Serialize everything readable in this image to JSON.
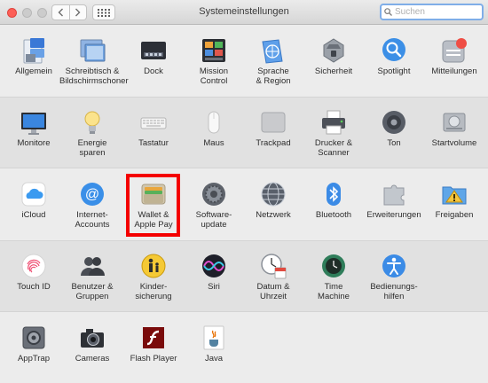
{
  "window": {
    "title": "Systemeinstellungen"
  },
  "search": {
    "placeholder": "Suchen",
    "value": ""
  },
  "rows": [
    [
      "Allgemein",
      "Schreibtisch &\nBildschirmschoner",
      "Dock",
      "Mission\nControl",
      "Sprache\n& Region",
      "Sicherheit",
      "Spotlight",
      "Mitteilungen"
    ],
    [
      "Monitore",
      "Energie\nsparen",
      "Tastatur",
      "Maus",
      "Trackpad",
      "Drucker &\nScanner",
      "Ton",
      "Startvolume"
    ],
    [
      "iCloud",
      "Internet-\nAccounts",
      "Wallet &\nApple Pay",
      "Software-\nupdate",
      "Netzwerk",
      "Bluetooth",
      "Erweiterungen",
      "Freigaben"
    ],
    [
      "Touch ID",
      "Benutzer &\nGruppen",
      "Kinder-\nsicherung",
      "Siri",
      "Datum &\nUhrzeit",
      "Time\nMachine",
      "Bedienungs-\nhilfen"
    ],
    [
      "AppTrap",
      "Cameras",
      "Flash Player",
      "Java"
    ]
  ],
  "icons": [
    [
      "general-icon",
      "desktop-screensaver-icon",
      "dock-icon",
      "mission-control-icon",
      "language-region-icon",
      "security-icon",
      "spotlight-icon",
      "notifications-icon"
    ],
    [
      "displays-icon",
      "energy-saver-icon",
      "keyboard-icon",
      "mouse-icon",
      "trackpad-icon",
      "printers-scanners-icon",
      "sound-icon",
      "startup-disk-icon"
    ],
    [
      "icloud-icon",
      "internet-accounts-icon",
      "wallet-apple-pay-icon",
      "software-update-icon",
      "network-icon",
      "bluetooth-icon",
      "extensions-icon",
      "sharing-icon"
    ],
    [
      "touch-id-icon",
      "users-groups-icon",
      "parental-controls-icon",
      "siri-icon",
      "date-time-icon",
      "time-machine-icon",
      "accessibility-icon"
    ],
    [
      "apptrap-icon",
      "cameras-icon",
      "flash-player-icon",
      "java-icon"
    ]
  ],
  "highlight": {
    "target": "Wallet &\nApple Pay",
    "color": "#f40000"
  }
}
